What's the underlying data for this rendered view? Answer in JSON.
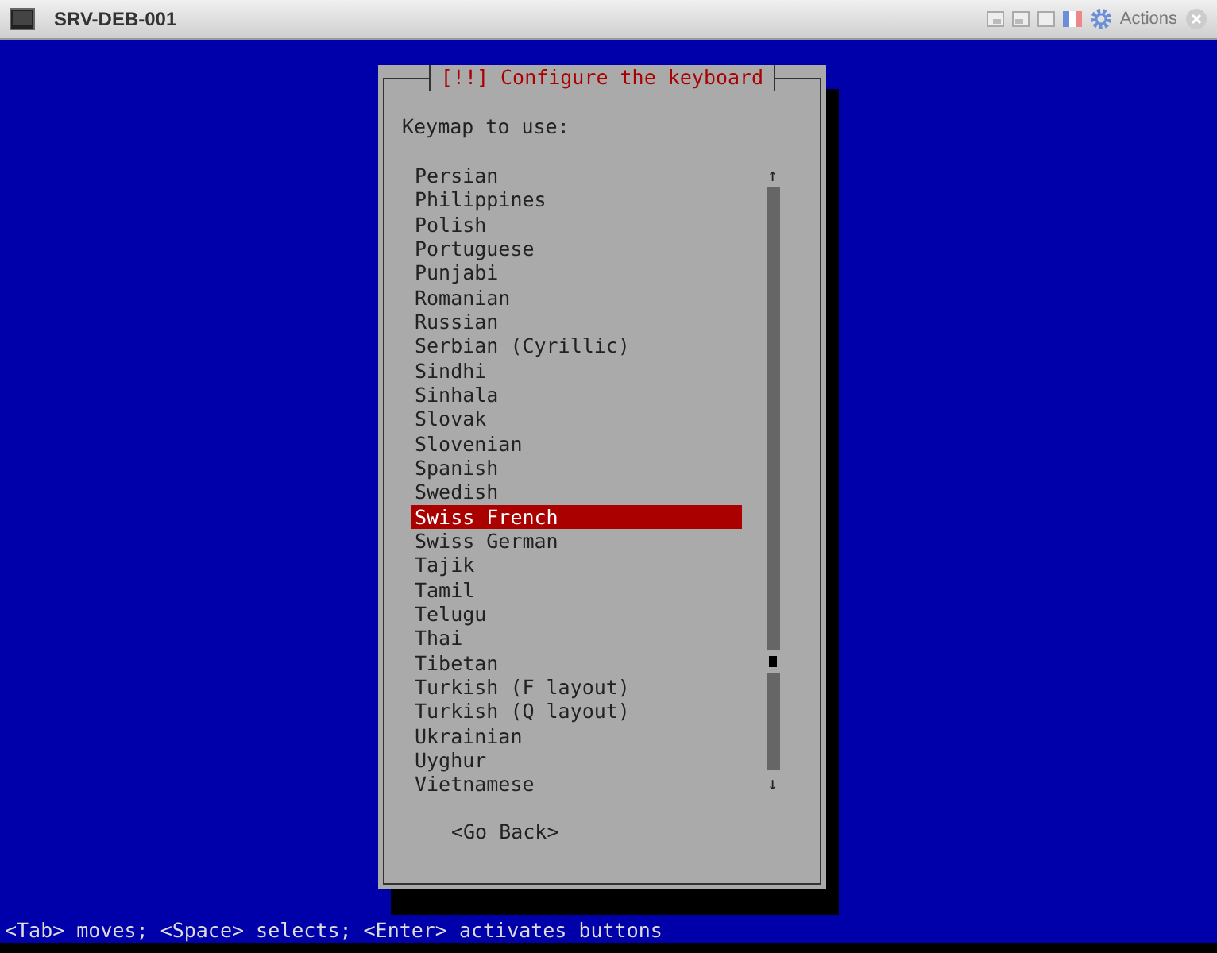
{
  "window": {
    "title": "SRV-DEB-001",
    "actions_label": "Actions"
  },
  "dialog": {
    "title": "[!!] Configure the keyboard",
    "prompt": "Keymap to use:",
    "items": [
      {
        "label": "Persian",
        "selected": false
      },
      {
        "label": "Philippines",
        "selected": false
      },
      {
        "label": "Polish",
        "selected": false
      },
      {
        "label": "Portuguese",
        "selected": false
      },
      {
        "label": "Punjabi",
        "selected": false
      },
      {
        "label": "Romanian",
        "selected": false
      },
      {
        "label": "Russian",
        "selected": false
      },
      {
        "label": "Serbian (Cyrillic)",
        "selected": false
      },
      {
        "label": "Sindhi",
        "selected": false
      },
      {
        "label": "Sinhala",
        "selected": false
      },
      {
        "label": "Slovak",
        "selected": false
      },
      {
        "label": "Slovenian",
        "selected": false
      },
      {
        "label": "Spanish",
        "selected": false
      },
      {
        "label": "Swedish",
        "selected": false
      },
      {
        "label": "Swiss French",
        "selected": true
      },
      {
        "label": "Swiss German",
        "selected": false
      },
      {
        "label": "Tajik",
        "selected": false
      },
      {
        "label": "Tamil",
        "selected": false
      },
      {
        "label": "Telugu",
        "selected": false
      },
      {
        "label": "Thai",
        "selected": false
      },
      {
        "label": "Tibetan",
        "selected": false
      },
      {
        "label": "Turkish (F layout)",
        "selected": false
      },
      {
        "label": "Turkish (Q layout)",
        "selected": false
      },
      {
        "label": "Ukrainian",
        "selected": false
      },
      {
        "label": "Uyghur",
        "selected": false
      },
      {
        "label": "Vietnamese",
        "selected": false
      }
    ],
    "scroll_up": "↑",
    "scroll_down": "↓",
    "back_button": "<Go Back>"
  },
  "status_bar": "<Tab> moves; <Space> selects; <Enter> activates buttons"
}
